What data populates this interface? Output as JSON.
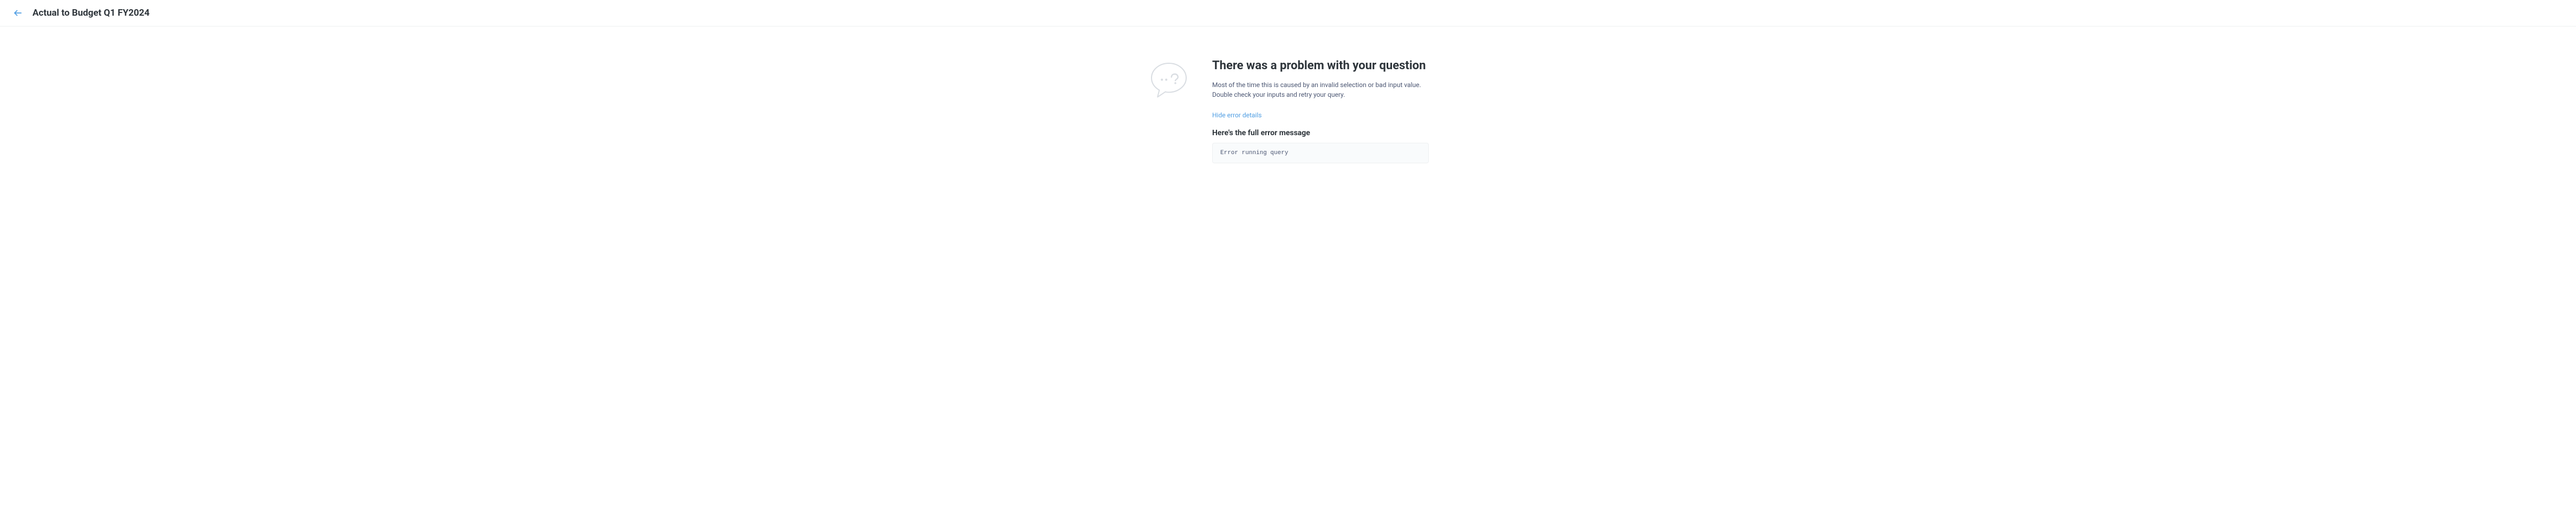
{
  "header": {
    "title": "Actual to Budget Q1 FY2024"
  },
  "error": {
    "title": "There was a problem with your question",
    "description": "Most of the time this is caused by an invalid selection or bad input value. Double check your inputs and retry your query.",
    "toggle_label": "Hide error details",
    "message_heading": "Here's the full error message",
    "message_body": "Error running query"
  }
}
